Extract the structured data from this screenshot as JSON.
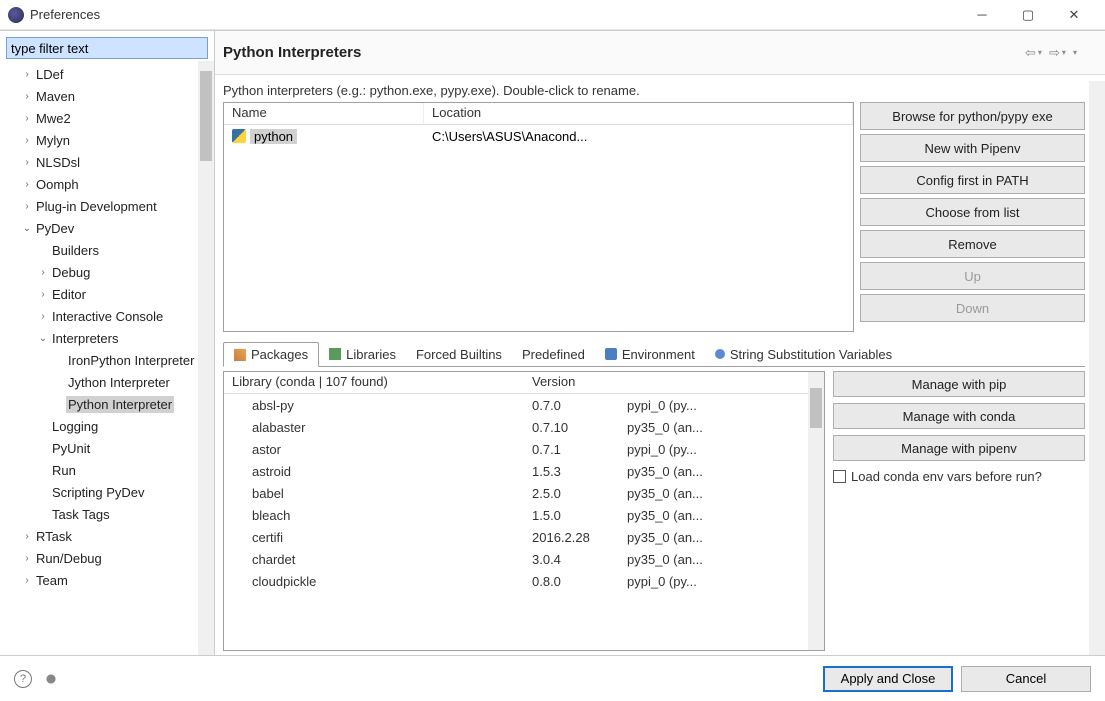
{
  "window": {
    "title": "Preferences"
  },
  "filter": {
    "placeholder": "type filter text"
  },
  "tree": [
    {
      "label": "LDef",
      "indent": 1,
      "arrow": "›"
    },
    {
      "label": "Maven",
      "indent": 1,
      "arrow": "›"
    },
    {
      "label": "Mwe2",
      "indent": 1,
      "arrow": "›"
    },
    {
      "label": "Mylyn",
      "indent": 1,
      "arrow": "›"
    },
    {
      "label": "NLSDsl",
      "indent": 1,
      "arrow": "›"
    },
    {
      "label": "Oomph",
      "indent": 1,
      "arrow": "›"
    },
    {
      "label": "Plug-in Development",
      "indent": 1,
      "arrow": "›"
    },
    {
      "label": "PyDev",
      "indent": 1,
      "arrow": "⌄"
    },
    {
      "label": "Builders",
      "indent": 2,
      "arrow": ""
    },
    {
      "label": "Debug",
      "indent": 2,
      "arrow": "›"
    },
    {
      "label": "Editor",
      "indent": 2,
      "arrow": "›"
    },
    {
      "label": "Interactive Console",
      "indent": 2,
      "arrow": "›"
    },
    {
      "label": "Interpreters",
      "indent": 2,
      "arrow": "⌄"
    },
    {
      "label": "IronPython Interpreter",
      "indent": 3,
      "arrow": ""
    },
    {
      "label": "Jython Interpreter",
      "indent": 3,
      "arrow": ""
    },
    {
      "label": "Python Interpreter",
      "indent": 3,
      "arrow": "",
      "selected": true
    },
    {
      "label": "Logging",
      "indent": 2,
      "arrow": ""
    },
    {
      "label": "PyUnit",
      "indent": 2,
      "arrow": ""
    },
    {
      "label": "Run",
      "indent": 2,
      "arrow": ""
    },
    {
      "label": "Scripting PyDev",
      "indent": 2,
      "arrow": ""
    },
    {
      "label": "Task Tags",
      "indent": 2,
      "arrow": ""
    },
    {
      "label": "RTask",
      "indent": 1,
      "arrow": "›"
    },
    {
      "label": "Run/Debug",
      "indent": 1,
      "arrow": "›"
    },
    {
      "label": "Team",
      "indent": 1,
      "arrow": "›"
    }
  ],
  "pane": {
    "title": "Python Interpreters",
    "description": "Python interpreters (e.g.: python.exe, pypy.exe).   Double-click to rename."
  },
  "interpreters": {
    "columns": {
      "name": "Name",
      "location": "Location"
    },
    "rows": [
      {
        "name": "python",
        "location": "C:\\Users\\ASUS\\Anacond..."
      }
    ]
  },
  "sideButtons": {
    "browse": "Browse for python/pypy exe",
    "pipenv": "New with Pipenv",
    "config": "Config first in PATH",
    "choose": "Choose from list",
    "remove": "Remove",
    "up": "Up",
    "down": "Down"
  },
  "tabs": [
    {
      "label": "Packages",
      "icon": "pkg",
      "active": true
    },
    {
      "label": "Libraries",
      "icon": "lib"
    },
    {
      "label": "Forced Builtins"
    },
    {
      "label": "Predefined"
    },
    {
      "label": "Environment",
      "icon": "env"
    },
    {
      "label": "String Substitution Variables",
      "icon": "str"
    }
  ],
  "packages": {
    "header": {
      "lib": "Library (conda | 107 found)",
      "ver": "Version",
      "src": ""
    },
    "rows": [
      {
        "lib": "absl-py",
        "ver": "0.7.0",
        "src": "pypi_0 (py..."
      },
      {
        "lib": "alabaster",
        "ver": "0.7.10",
        "src": "py35_0 (an..."
      },
      {
        "lib": "astor",
        "ver": "0.7.1",
        "src": "pypi_0 (py..."
      },
      {
        "lib": "astroid",
        "ver": "1.5.3",
        "src": "py35_0 (an..."
      },
      {
        "lib": "babel",
        "ver": "2.5.0",
        "src": "py35_0 (an..."
      },
      {
        "lib": "bleach",
        "ver": "1.5.0",
        "src": "py35_0 (an..."
      },
      {
        "lib": "certifi",
        "ver": "2016.2.28",
        "src": "py35_0 (an..."
      },
      {
        "lib": "chardet",
        "ver": "3.0.4",
        "src": "py35_0 (an..."
      },
      {
        "lib": "cloudpickle",
        "ver": "0.8.0",
        "src": "pypi_0 (py..."
      }
    ]
  },
  "mgrButtons": {
    "pip": "Manage with pip",
    "conda": "Manage with conda",
    "pipenv": "Manage with pipenv",
    "checkbox": "Load conda env vars before run?"
  },
  "footer": {
    "apply": "Apply and Close",
    "cancel": "Cancel"
  },
  "watermark": ""
}
